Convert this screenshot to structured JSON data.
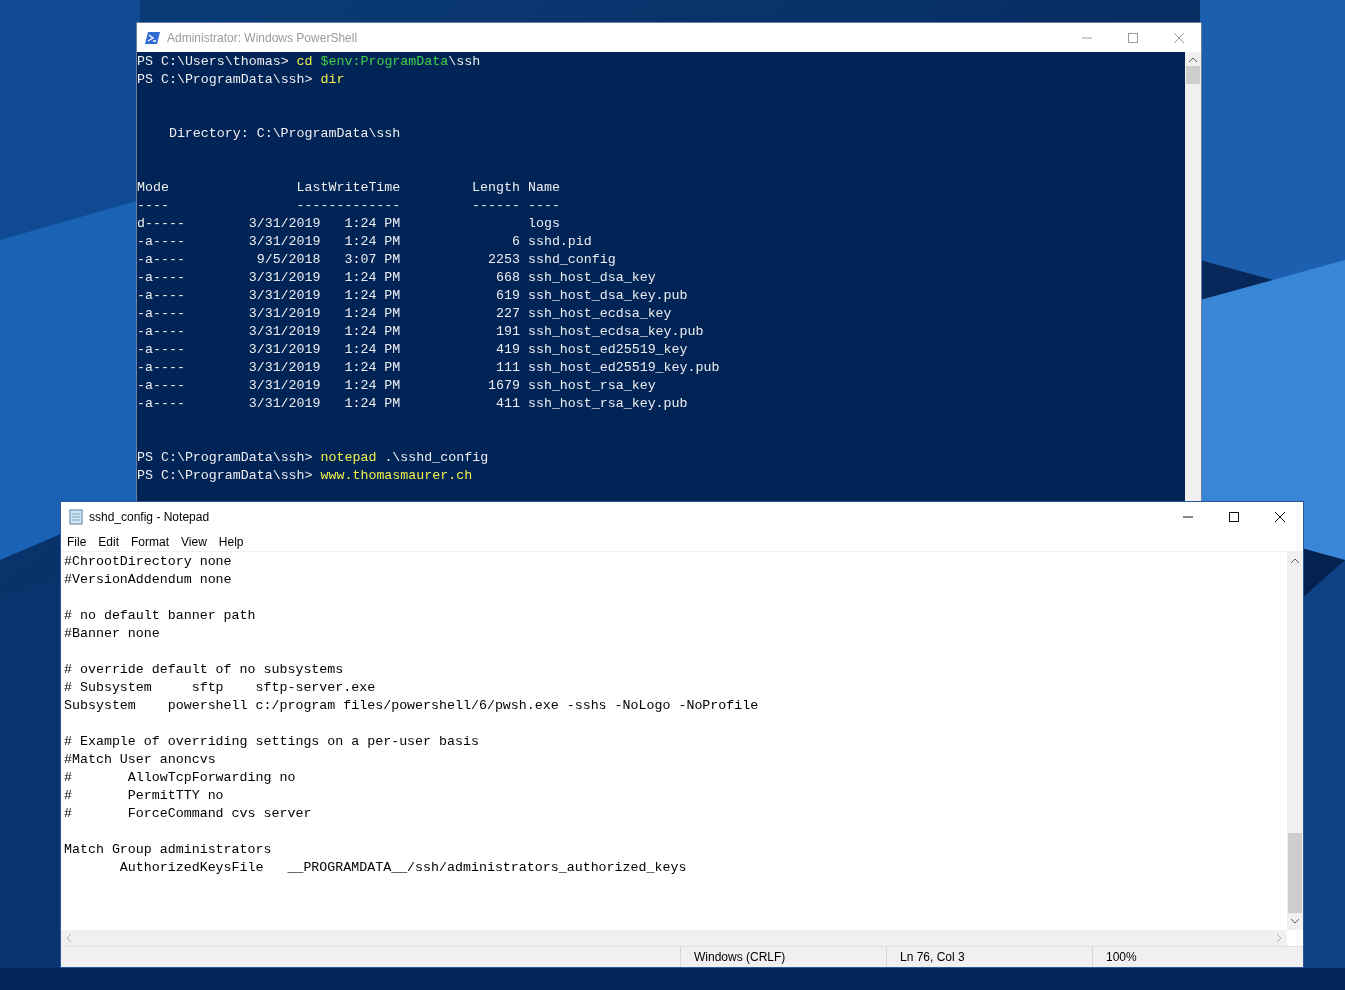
{
  "powershell": {
    "title": "Administrator: Windows PowerShell",
    "lines_top": [
      {
        "kind": "prompt",
        "prompt": "PS C:\\Users\\thomas> ",
        "segments": [
          {
            "text": "cd ",
            "kind": "command"
          },
          {
            "text": "$env:ProgramData",
            "kind": "variable"
          },
          {
            "text": "\\ssh",
            "kind": "argument"
          }
        ]
      },
      {
        "kind": "prompt",
        "prompt": "PS C:\\ProgramData\\ssh> ",
        "segments": [
          {
            "text": "dir",
            "kind": "command"
          }
        ]
      },
      {
        "kind": "blank"
      },
      {
        "kind": "blank"
      },
      {
        "kind": "output",
        "text": "Directory: C:\\ProgramData\\ssh"
      },
      {
        "kind": "blank"
      },
      {
        "kind": "blank"
      }
    ],
    "table": {
      "columns": [
        {
          "label": "Mode",
          "rule": "----"
        },
        {
          "label": "LastWriteTime",
          "rule": "-------------"
        },
        {
          "label": "Length",
          "rule": "------"
        },
        {
          "label": "Name",
          "rule": "----"
        }
      ],
      "rows": [
        {
          "mode": "d-----",
          "date": "3/31/2019",
          "time": "1:24 PM",
          "name": "logs"
        },
        {
          "mode": "-a----",
          "date": "3/31/2019",
          "time": "1:24 PM",
          "length": "6",
          "name": "sshd.pid"
        },
        {
          "mode": "-a----",
          "date": "9/5/2018",
          "time": "3:07 PM",
          "length": "2253",
          "name": "sshd_config"
        },
        {
          "mode": "-a----",
          "date": "3/31/2019",
          "time": "1:24 PM",
          "length": "668",
          "name": "ssh_host_dsa_key"
        },
        {
          "mode": "-a----",
          "date": "3/31/2019",
          "time": "1:24 PM",
          "length": "619",
          "name": "ssh_host_dsa_key.pub"
        },
        {
          "mode": "-a----",
          "date": "3/31/2019",
          "time": "1:24 PM",
          "length": "227",
          "name": "ssh_host_ecdsa_key"
        },
        {
          "mode": "-a----",
          "date": "3/31/2019",
          "time": "1:24 PM",
          "length": "191",
          "name": "ssh_host_ecdsa_key.pub"
        },
        {
          "mode": "-a----",
          "date": "3/31/2019",
          "time": "1:24 PM",
          "length": "419",
          "name": "ssh_host_ed25519_key"
        },
        {
          "mode": "-a----",
          "date": "3/31/2019",
          "time": "1:24 PM",
          "length": "111",
          "name": "ssh_host_ed25519_key.pub"
        },
        {
          "mode": "-a----",
          "date": "3/31/2019",
          "time": "1:24 PM",
          "length": "1679",
          "name": "ssh_host_rsa_key"
        },
        {
          "mode": "-a----",
          "date": "3/31/2019",
          "time": "1:24 PM",
          "length": "411",
          "name": "ssh_host_rsa_key.pub"
        }
      ]
    },
    "lines_bottom": [
      {
        "kind": "blank"
      },
      {
        "kind": "blank"
      },
      {
        "kind": "prompt",
        "prompt": "PS C:\\ProgramData\\ssh> ",
        "segments": [
          {
            "text": "notepad ",
            "kind": "command"
          },
          {
            "text": ".\\sshd_config",
            "kind": "argument"
          }
        ]
      },
      {
        "kind": "prompt",
        "prompt": "PS C:\\ProgramData\\ssh> ",
        "segments": [
          {
            "text": "www.thomasmaurer.ch",
            "kind": "command"
          }
        ]
      }
    ]
  },
  "notepad": {
    "title": "sshd_config - Notepad",
    "menu": [
      "File",
      "Edit",
      "Format",
      "View",
      "Help"
    ],
    "blocks": [
      [
        "#ChrootDirectory none",
        "#VersionAddendum none"
      ],
      [
        "# no default banner path",
        "#Banner none"
      ],
      [
        "# override default of no subsystems",
        "# Subsystem     sftp    sftp-server.exe",
        "Subsystem    powershell c:/program files/powershell/6/pwsh.exe -sshs -NoLogo -NoProfile"
      ],
      [
        "# Example of overriding settings on a per-user basis",
        "#Match User anoncvs",
        "#       AllowTcpForwarding no",
        "#       PermitTTY no",
        "#       ForceCommand cvs server"
      ],
      [
        "Match Group administrators",
        "       AuthorizedKeysFile   __PROGRAMDATA__/ssh/administrators_authorized_keys"
      ]
    ],
    "status": [
      "Windows (CRLF)",
      "Ln 76, Col 3",
      "100%"
    ]
  }
}
